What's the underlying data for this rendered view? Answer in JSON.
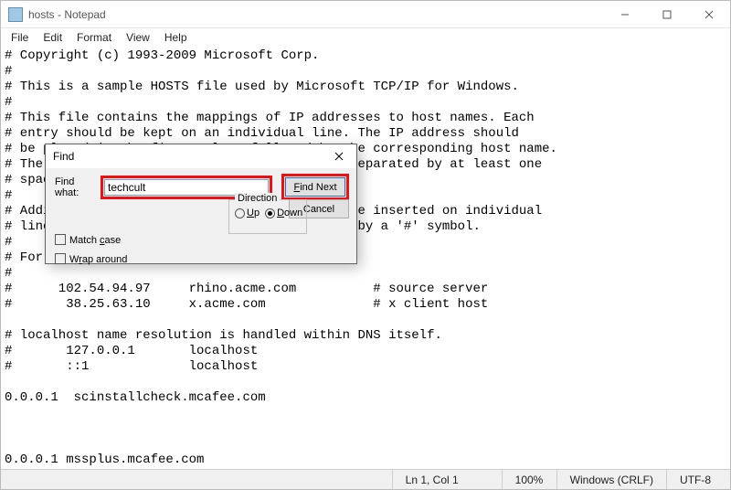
{
  "window": {
    "title": "hosts - Notepad"
  },
  "menu": {
    "file": "File",
    "edit": "Edit",
    "format": "Format",
    "view": "View",
    "help": "Help"
  },
  "document_text": "# Copyright (c) 1993-2009 Microsoft Corp.\n#\n# This is a sample HOSTS file used by Microsoft TCP/IP for Windows.\n#\n# This file contains the mappings of IP addresses to host names. Each\n# entry should be kept on an individual line. The IP address should\n# be placed in the first column followed by the corresponding host name.\n# The IP address and the host name should be separated by at least one\n# space.\n#\n# Additionally, comments (such as these) may be inserted on individual\n# lines or following the machine name denoted by a '#' symbol.\n#\n# For example:\n#\n#      102.54.94.97     rhino.acme.com          # source server\n#       38.25.63.10     x.acme.com              # x client host\n\n# localhost name resolution is handled within DNS itself.\n#       127.0.0.1       localhost\n#       ::1             localhost\n\n0.0.0.1  scinstallcheck.mcafee.com\n\n\n\n0.0.0.1 mssplus.mcafee.com",
  "find": {
    "title": "Find",
    "label": "Find what:",
    "value": "techcult",
    "find_next": "Find Next",
    "cancel": "Cancel",
    "direction_label": "Direction",
    "up": "Up",
    "down": "Down",
    "selected_direction": "down",
    "match_case": "Match case",
    "wrap_around": "Wrap around"
  },
  "statusbar": {
    "position": "Ln 1, Col 1",
    "zoom": "100%",
    "line_ending": "Windows (CRLF)",
    "encoding": "UTF-8"
  }
}
